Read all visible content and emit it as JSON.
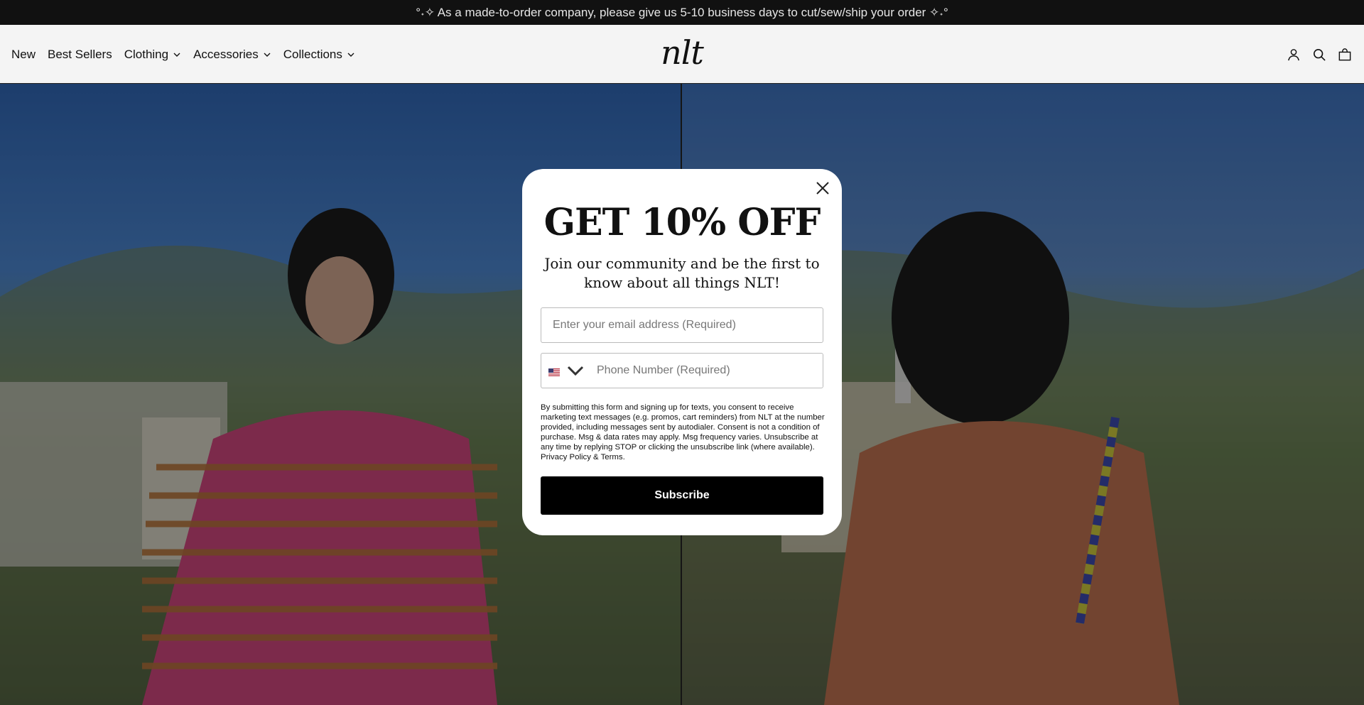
{
  "announcement": "°˖✧ As a made-to-order company, please give us 5-10 business days to cut/sew/ship your order ✧˖°",
  "nav": {
    "items": [
      {
        "label": "New",
        "has_dropdown": false
      },
      {
        "label": "Best Sellers",
        "has_dropdown": false
      },
      {
        "label": "Clothing",
        "has_dropdown": true
      },
      {
        "label": "Accessories",
        "has_dropdown": true
      },
      {
        "label": "Collections",
        "has_dropdown": true
      }
    ]
  },
  "logo": "nlt",
  "header_icons": [
    "account-icon",
    "search-icon",
    "bag-icon"
  ],
  "modal": {
    "title": "GET 10% OFF",
    "subtitle": "Join our community and be the first to know about all things NLT!",
    "email_placeholder": "Enter your email address (Required)",
    "phone_placeholder": "Phone Number (Required)",
    "country_flag": "us-flag-icon",
    "legal": "By submitting this form and signing up for texts, you consent to receive marketing text messages (e.g. promos, cart reminders) from NLT at the number provided, including messages sent by autodialer. Consent is not a condition of purchase. Msg & data rates may apply. Msg frequency varies. Unsubscribe at any time by replying STOP or clicking the unsubscribe link (where available). Privacy Policy & Terms.",
    "subscribe_label": "Subscribe"
  },
  "colors": {
    "accent": "#000000",
    "header_bg": "#f4f4f4",
    "announcement_bg": "#111111"
  }
}
